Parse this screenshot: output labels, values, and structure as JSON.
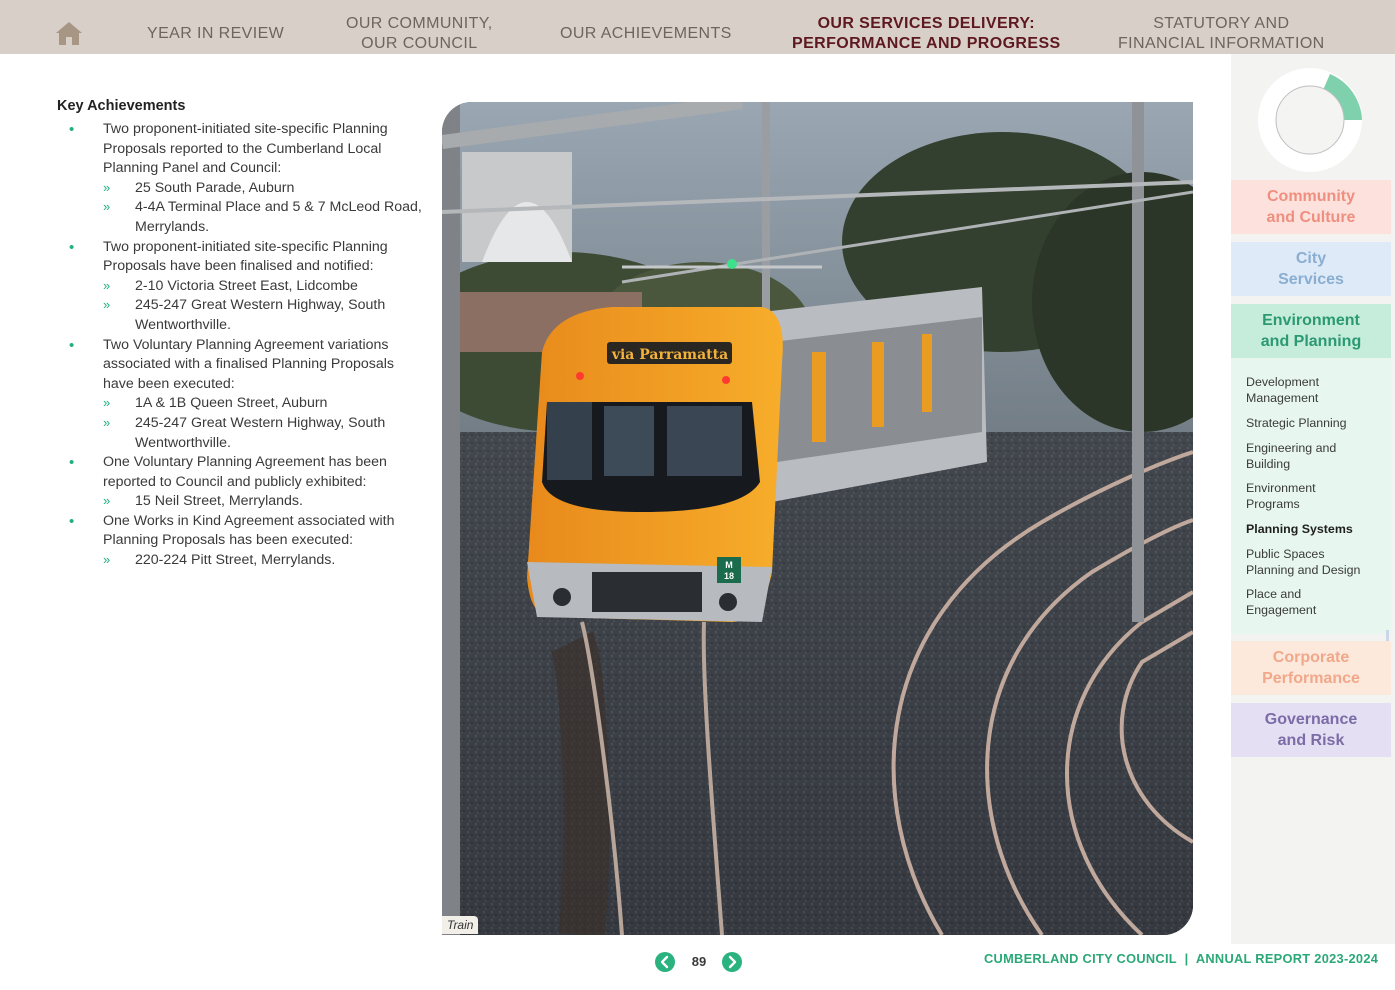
{
  "nav": {
    "items": [
      {
        "label": "YEAR IN REVIEW"
      },
      {
        "line1": "OUR COMMUNITY,",
        "line2": "OUR COUNCIL"
      },
      {
        "label": "OUR ACHIEVEMENTS"
      },
      {
        "line1": "OUR SERVICES DELIVERY:",
        "line2": "PERFORMANCE AND PROGRESS"
      },
      {
        "line1": "STATUTORY AND",
        "line2": "FINANCIAL INFORMATION"
      }
    ],
    "home_icon": "home-icon",
    "active_color": "#5e1820"
  },
  "content": {
    "heading": "Key Achievements",
    "items": [
      {
        "text": "Two proponent-initiated site-specific Planning Proposals reported to the Cumberland Local Planning Panel and Council:",
        "sub": [
          "25 South Parade, Auburn",
          "4-4A Terminal Place and 5 & 7 McLeod Road, Merrylands."
        ]
      },
      {
        "text": "Two proponent-initiated site-specific Planning Proposals have been finalised and notified:",
        "sub": [
          "2-10 Victoria Street East, Lidcombe",
          "245-247 Great Western Highway, South Wentworthville."
        ]
      },
      {
        "text": "Two Voluntary Planning Agreement variations associated with a finalised Planning Proposals have been executed:",
        "sub": [
          "1A & 1B Queen Street, Auburn",
          "245-247 Great Western Highway, South Wentworthville."
        ]
      },
      {
        "text": "One Voluntary Planning Agreement has been reported to Council and publicly exhibited:",
        "sub": [
          "15 Neil Street, Merrylands."
        ]
      },
      {
        "text": "One Works in Kind Agreement associated with Planning Proposals has been executed:",
        "sub": [
          "220-224 Pitt Street, Merrylands."
        ]
      }
    ]
  },
  "photo": {
    "caption": "Train",
    "destination_sign": "via Parramatta",
    "car_number_top": "M",
    "car_number_bottom": "18"
  },
  "sidebar": {
    "tabs": {
      "community": {
        "line1": "Community",
        "line2": "and Culture"
      },
      "city": {
        "line1": "City",
        "line2": "Services"
      },
      "env": {
        "line1": "Environment",
        "line2": "and Planning"
      },
      "corp": {
        "line1": "Corporate",
        "line2": "Performance"
      },
      "gov": {
        "line1": "Governance",
        "line2": "and Risk"
      }
    },
    "sub_items": [
      {
        "line1": "Development",
        "line2": "Management"
      },
      {
        "line1": "Strategic Planning",
        "line2": ""
      },
      {
        "line1": "Engineering and",
        "line2": "Building"
      },
      {
        "line1": "Environment",
        "line2": "Programs"
      },
      {
        "line1": "Planning Systems",
        "line2": ""
      },
      {
        "line1": "Public Spaces",
        "line2": "Planning and Design"
      },
      {
        "line1": "Place and",
        "line2": "Engagement"
      }
    ],
    "ring_accent": "#7fd1ad"
  },
  "footer": {
    "page_number": "89",
    "org": "CUMBERLAND CITY COUNCIL",
    "separator": "|",
    "report": "ANNUAL REPORT 2023-2024",
    "prev_icon": "chevron-left-icon",
    "next_icon": "chevron-right-icon",
    "accent": "#2ab27f"
  }
}
